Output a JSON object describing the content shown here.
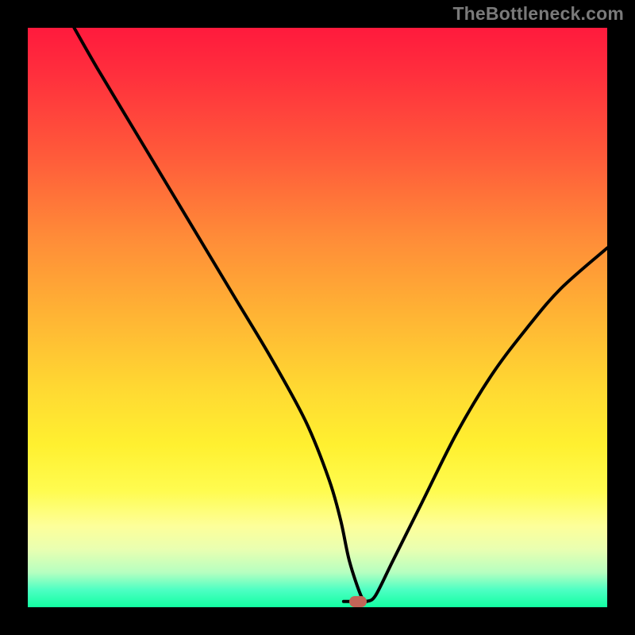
{
  "watermark": "TheBottleneck.com",
  "colors": {
    "frame": "#000000",
    "curve_stroke": "#000000",
    "marker_fill": "#c26457",
    "watermark_text": "#7a7a7a"
  },
  "chart_data": {
    "type": "line",
    "title": "",
    "xlabel": "",
    "ylabel": "",
    "xlim": [
      0,
      100
    ],
    "ylim": [
      0,
      100
    ],
    "grid": false,
    "legend": false,
    "series": [
      {
        "name": "bottleneck-curve",
        "x": [
          8,
          12,
          18,
          24,
          30,
          36,
          42,
          48,
          52,
          54,
          55.5,
          57.5,
          58.5,
          60,
          63,
          68,
          74,
          80,
          86,
          92,
          100
        ],
        "y": [
          100,
          93,
          83,
          73,
          63,
          53,
          43,
          32,
          22,
          15,
          8,
          2,
          1,
          2,
          8,
          18,
          30,
          40,
          48,
          55,
          62
        ]
      }
    ],
    "flat_bottom": {
      "x_start": 54.5,
      "x_end": 58.5,
      "y": 1
    },
    "marker": {
      "x": 57,
      "y": 1
    },
    "background_gradient": {
      "orientation": "vertical",
      "stops": [
        {
          "pos": 0.0,
          "color": "#ff1a3d"
        },
        {
          "pos": 0.22,
          "color": "#ff5a3a"
        },
        {
          "pos": 0.5,
          "color": "#ffb534"
        },
        {
          "pos": 0.72,
          "color": "#fff030"
        },
        {
          "pos": 0.86,
          "color": "#fdff9a"
        },
        {
          "pos": 0.94,
          "color": "#b6ffc0"
        },
        {
          "pos": 1.0,
          "color": "#12ffa2"
        }
      ]
    }
  }
}
